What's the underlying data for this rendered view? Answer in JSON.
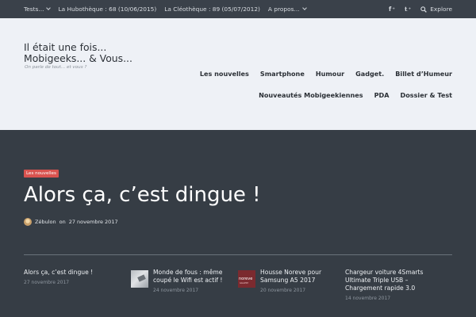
{
  "topbar": {
    "menu": [
      {
        "label": "Tests...",
        "has_dropdown": true
      },
      {
        "label": "La Hubothèque : 68 (10/06/2015)",
        "has_dropdown": false
      },
      {
        "label": "La Cléothèque : 89 (05/07/2012)",
        "has_dropdown": false
      },
      {
        "label": "A propos...",
        "has_dropdown": true
      }
    ],
    "facebook_letter": "f",
    "twitter_letter": "t",
    "explore_label": "Explore"
  },
  "header": {
    "title_line1": "Il était une fois...",
    "title_line2": "Mobigeeks... & Vous...",
    "tagline": "On parle de tout... et vous ?",
    "nav_row1": [
      "Les nouvelles",
      "Smartphone",
      "Humour",
      "Gadget.",
      "Billet d’Humeur"
    ],
    "nav_row2": [
      "Nouveautés Mobigeekiennes",
      "PDA",
      "Dossier & Test"
    ]
  },
  "featured": {
    "category": "Les nouvelles",
    "title": "Alors ça, c’est dingue !",
    "author": "Zébulon",
    "on": "on",
    "date": "27 novembre 2017"
  },
  "related": [
    {
      "title_lines": [
        "Alors ça, c’est dingue !"
      ],
      "date": "27 novembre 2017"
    },
    {
      "title_lines": [
        "Monde de fous : même",
        "coupé le Wifi est actif !"
      ],
      "date": "24 novembre 2017"
    },
    {
      "title_lines": [
        "Housse Noreve pour",
        "Samsung A5 2017"
      ],
      "date": "20 novembre 2017"
    },
    {
      "title_lines": [
        "Chargeur voiture 4Smarts",
        "Ultimate Triple USB –",
        "Chargement rapide 3.0"
      ],
      "date": "14 novembre 2017"
    }
  ],
  "thumb_noreve_text": "noreve",
  "thumb_noreve_sub": "GALLERY",
  "colors": {
    "topbar_bg": "#3a414a",
    "header_bg": "#eef1f6",
    "body_bg": "#363d45",
    "badge_bg": "#d9534f"
  }
}
